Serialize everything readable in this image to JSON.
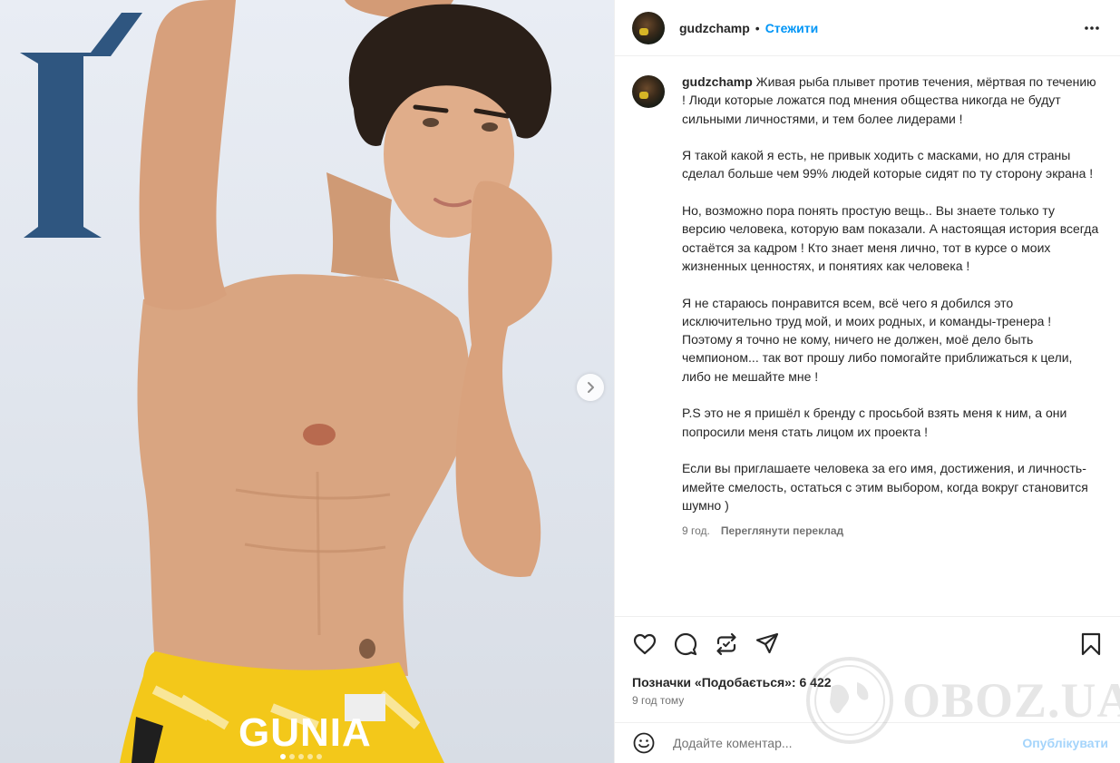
{
  "post": {
    "brand_text": "GUNIA",
    "carousel": {
      "count": 5,
      "active": 0
    }
  },
  "header": {
    "username": "gudzchamp",
    "separator": "•",
    "follow_label": "Стежити"
  },
  "caption": {
    "username": "gudzchamp",
    "paragraphs": [
      "Живая рыба плывет против течения, мёртвая по течению ! Люди которые ложатся под мнения общества никогда не будут сильными личностями, и тем более лидерами !",
      "Я такой какой я есть, не привык ходить с масками, но для страны сделал больше чем 99% людей которые сидят по ту сторону экрана !",
      "Но, возможно пора понять простую вещь.. Вы знаете только ту версию человека, которую вам показали. А настоящая история всегда остаётся за кадром ! Кто знает меня лично, тот в курсе о моих жизненных ценностях, и понятиях как человека !",
      "Я не стараюсь понравится всем, всё чего я добился это исключительно труд мой, и моих родных, и команды-тренера ! Поэтому я точно не кому, ничего не должен, моё дело быть чемпионом... так вот прошу либо помогайте приближаться к цели, либо не мешайте мне !",
      "P.S это не я пришёл к бренду с просьбой взять меня к ним, а они попросили меня стать лицом их проекта !",
      "Если вы приглашаете человека за его имя, достижения, и личность- имейте смелость, остаться с этим выбором, когда вокруг становится шумно )"
    ],
    "time": "9 год.",
    "translate_label": "Переглянути переклад"
  },
  "actions": {
    "icons": [
      "heart-icon",
      "comment-icon",
      "repost-icon",
      "share-icon",
      "bookmark-icon"
    ]
  },
  "likes_text": "Позначки «Подобається»: 6 422",
  "time_ago": "9 год тому",
  "comment": {
    "placeholder": "Додайте коментар...",
    "publish_label": "Опублікувати"
  },
  "watermark": {
    "text": "OBOZ.UA"
  },
  "colors": {
    "accent": "#0095f6",
    "publish_disabled": "#a4d4fb",
    "text": "#262626",
    "muted": "#737373"
  }
}
